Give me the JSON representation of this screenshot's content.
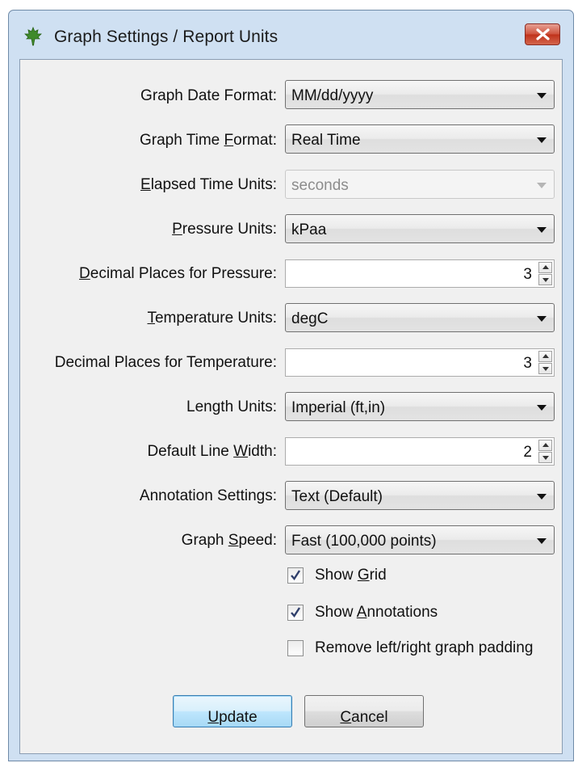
{
  "window": {
    "title": "Graph Settings / Report Units",
    "accent_color": "#c0321b"
  },
  "fields": {
    "graph_date_format": {
      "label_pre": "Graph Date Format:",
      "value": "MM/dd/yyyy"
    },
    "graph_time_format": {
      "label_pre": "Graph Time ",
      "label_u": "F",
      "label_post": "ormat:",
      "value": "Real Time"
    },
    "elapsed_time_units": {
      "label_u": "E",
      "label_post": "lapsed Time Units:",
      "value": "seconds"
    },
    "pressure_units": {
      "label_u": "P",
      "label_post": "ressure Units:",
      "value": "kPaa"
    },
    "decimal_places_pressure": {
      "label_u": "D",
      "label_post": "ecimal Places for Pressure:",
      "value": "3"
    },
    "temperature_units": {
      "label_u": "T",
      "label_post": "emperature Units:",
      "value": "degC"
    },
    "decimal_places_temperature": {
      "label_pre": "Decimal Places for Temperature:",
      "value": "3"
    },
    "length_units": {
      "label_pre": "Length Units:",
      "value": "Imperial (ft,in)"
    },
    "default_line_width": {
      "label_pre": "Default Line ",
      "label_u": "W",
      "label_post": "idth:",
      "value": "2"
    },
    "annotation_settings": {
      "label_pre": "Annotation Settings:",
      "value": "Text (Default)"
    },
    "graph_speed": {
      "label_pre": "Graph ",
      "label_u": "S",
      "label_post": "peed:",
      "value": "Fast (100,000 points)"
    }
  },
  "checkboxes": {
    "show_grid": {
      "label_pre": "Show ",
      "label_u": "G",
      "label_post": "rid",
      "checked": true
    },
    "show_annotations": {
      "label_pre": "Show ",
      "label_u": "A",
      "label_post": "nnotations",
      "checked": true
    },
    "remove_padding": {
      "label_pre": "Remove left/right graph padding",
      "checked": false
    }
  },
  "buttons": {
    "update": {
      "label_u": "U",
      "label_post": "pdate"
    },
    "cancel": {
      "label_u": "C",
      "label_post": "ancel"
    }
  },
  "icons": {
    "app": "maple-leaf-icon",
    "close": "close-icon",
    "dropdown": "chevron-down-icon",
    "check": "checkmark-icon"
  }
}
